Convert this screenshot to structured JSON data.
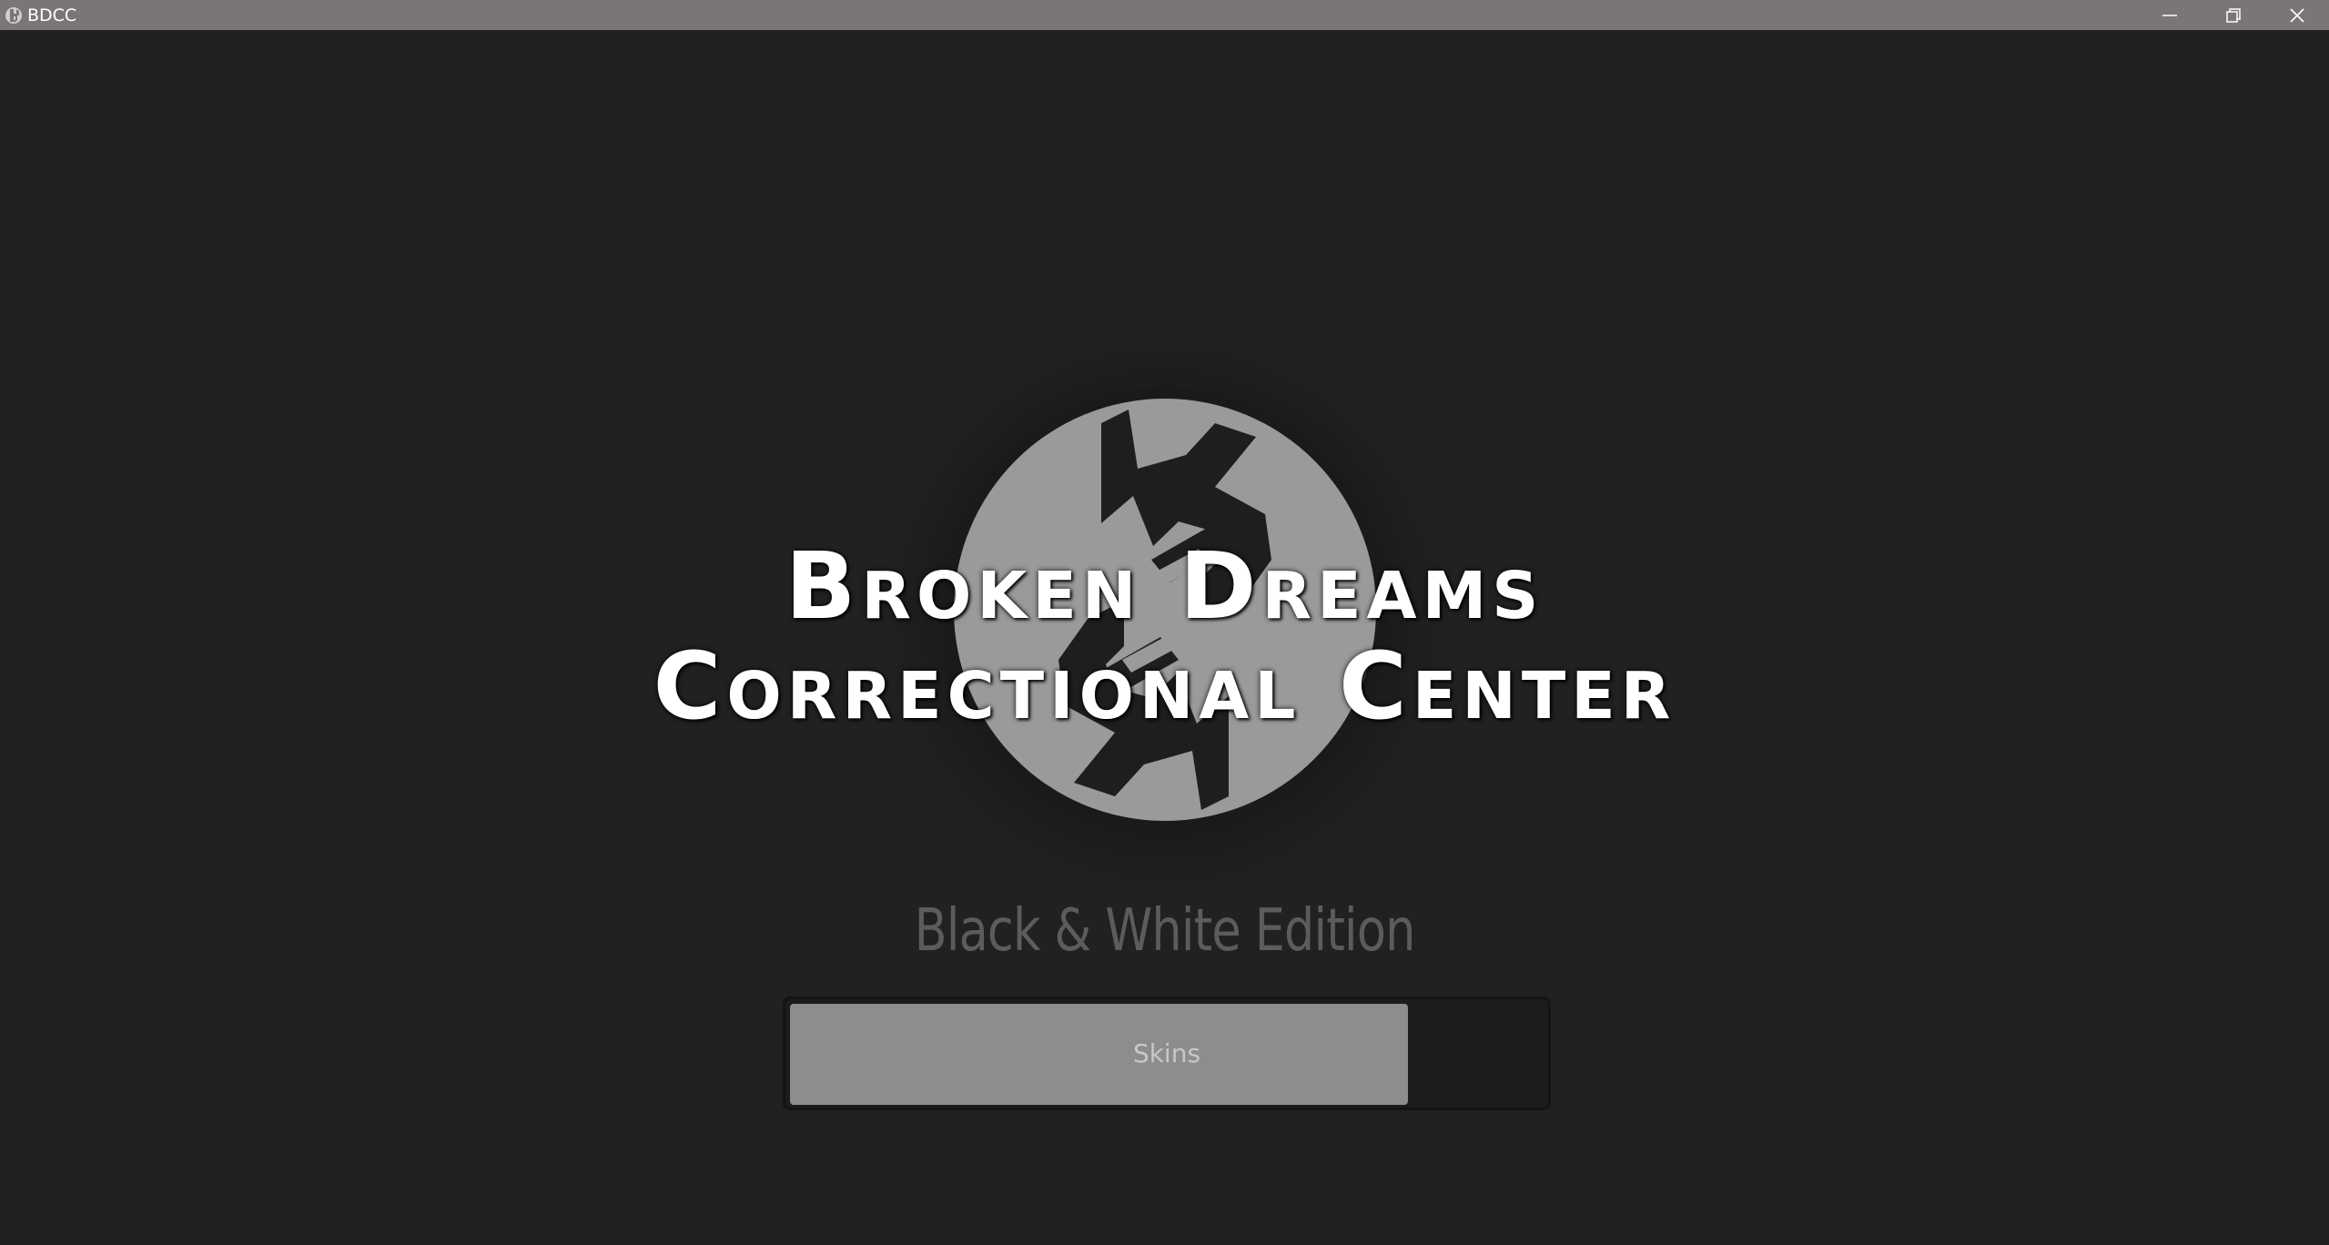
{
  "window": {
    "title": "BDCC",
    "controls": [
      "minimize",
      "maximize",
      "close"
    ]
  },
  "splash": {
    "title_line_1": "Broken Dreams",
    "title_line_2": "Correctional Center",
    "edition": "Black & White Edition",
    "emblem_icon": "broken-chain-emblem-icon"
  },
  "loading": {
    "label": "Skins",
    "progress_fraction": 0.82
  },
  "colors": {
    "background": "#212121",
    "titlebar": "#7b7576",
    "emblem": "#9a9a9a",
    "progress_fill": "#8d8d8d",
    "edition_text": "#5c5c5c"
  }
}
